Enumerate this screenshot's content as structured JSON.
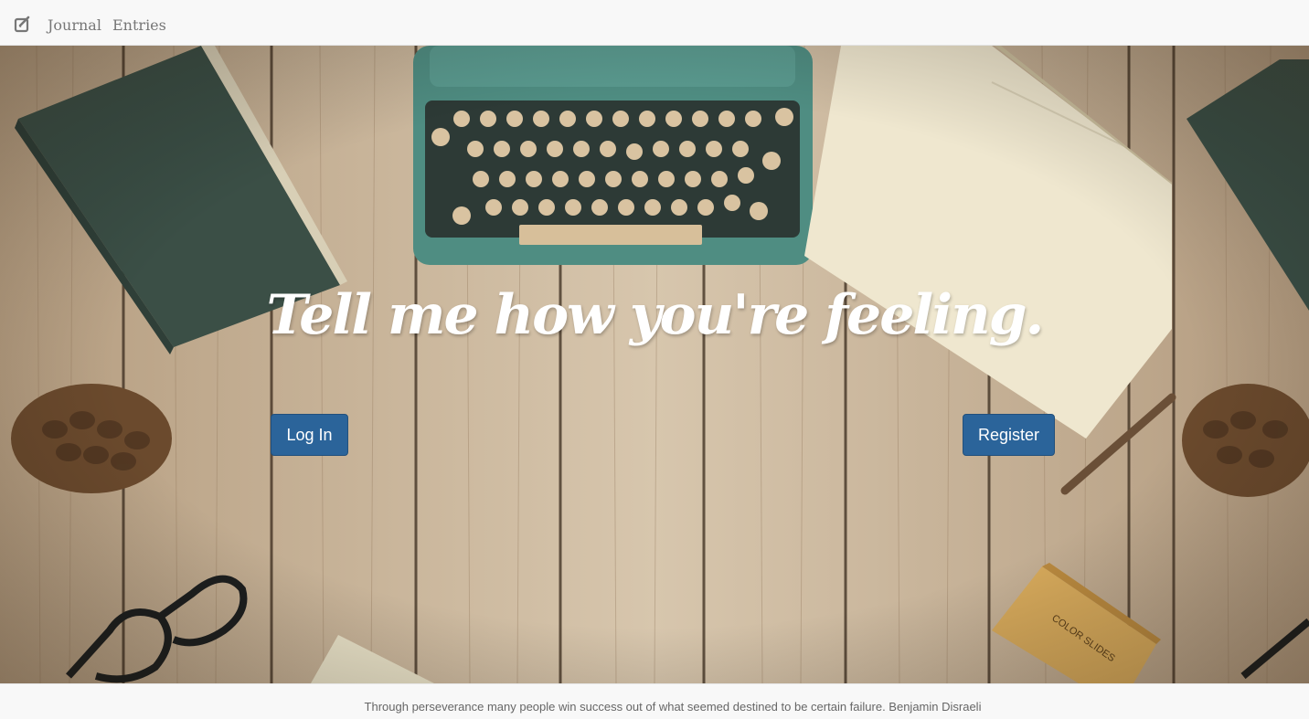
{
  "navbar": {
    "brand_icon": "edit-icon",
    "links": [
      {
        "label": "Journal"
      },
      {
        "label": "Entries"
      }
    ]
  },
  "hero": {
    "headline": "Tell me how you're feeling.",
    "login_label": "Log In",
    "register_label": "Register",
    "colors": {
      "button": "#2b649a",
      "wood": "#c9b69b"
    }
  },
  "footer": {
    "quote": "Through perseverance many people win success out of what seemed destined to be certain failure. Benjamin Disraeli"
  }
}
